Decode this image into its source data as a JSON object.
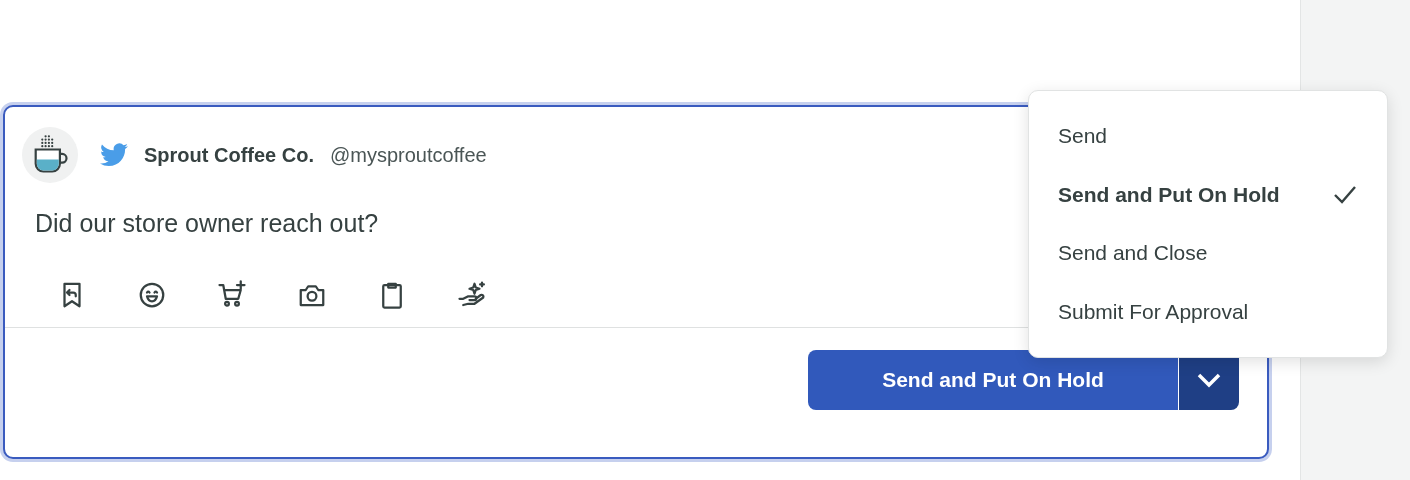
{
  "composer": {
    "account_name": "Sprout Coffee Co.",
    "account_handle": "@mysproutcoffee",
    "message": "Did our store owner reach out?",
    "send_button": "Send and Put On Hold"
  },
  "send_menu": [
    {
      "label": "Send",
      "selected": false
    },
    {
      "label": "Send and Put On Hold",
      "selected": true
    },
    {
      "label": "Send and Close",
      "selected": false
    },
    {
      "label": "Submit For Approval",
      "selected": false
    }
  ]
}
